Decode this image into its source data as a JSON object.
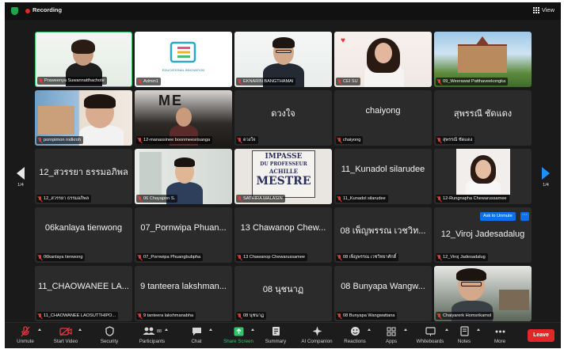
{
  "topbar": {
    "recording_label": "Recording",
    "view_label": "View"
  },
  "pager": {
    "left_page": "1/4",
    "right_page": "1/4"
  },
  "tiles": [
    {
      "name": "Praweenya Suwannatthachote",
      "type": "video"
    },
    {
      "name": "Admin1",
      "type": "video"
    },
    {
      "name": "EKNARIN BANGTHAMAI",
      "type": "video"
    },
    {
      "name": "CEI SU",
      "type": "video"
    },
    {
      "name": "09_Weerawat Patthaveekongka",
      "type": "video"
    },
    {
      "name": "pornpimon rodkroh",
      "type": "video"
    },
    {
      "name": "12-manassinee boonmeesrisanga",
      "type": "video"
    },
    {
      "name": "ดวงใจ",
      "display": "ดวงใจ",
      "type": "text"
    },
    {
      "name": "chaiyong",
      "display": "chaiyong",
      "type": "text"
    },
    {
      "name": "สุพรรณี ชัดแดง",
      "display": "สุพรรณี ชัดแดง",
      "type": "text"
    },
    {
      "name": "12_สวรรยา ธรรมอภิพล",
      "display": "12_สวรรยา ธรรมอภิพล",
      "type": "text"
    },
    {
      "name": "06 Chayapon S.",
      "type": "video"
    },
    {
      "name": "SATHIRA MALASIN",
      "type": "video",
      "sign_lines": [
        "IMPASSE",
        "DU PROFESSEUR",
        "ACHILLE",
        "MESTRE"
      ]
    },
    {
      "name": "11_Kunadol silarudee",
      "display": "11_Kunadol silarudee",
      "type": "text"
    },
    {
      "name": "12-Rungnapha Chewarussamee",
      "type": "video"
    },
    {
      "name": "06kanlaya tienwong",
      "display": "06kanlaya tienwong",
      "type": "text"
    },
    {
      "name": "07_Pornwipa Phuangbubpha",
      "display": "07_Pornwipa Phuan...",
      "type": "text"
    },
    {
      "name": "13 Chawanop Chewarussamee",
      "display": "13 Chawanop Chew...",
      "type": "text"
    },
    {
      "name": "08 เพ็ญพรรณ เวชวิทยาศักดิ์",
      "display": "08 เพ็ญพรรณ เวชวิท...",
      "type": "text"
    },
    {
      "name": "12_Viroj Jadesadalug",
      "display": "12_Viroj Jadesadalug",
      "type": "text",
      "ask_to_unmute": "Ask to Unmute",
      "more": "···"
    },
    {
      "name": "11_CHAOWANEE LAOSUTTHIPO...",
      "display": "11_CHAOWANEE LA...",
      "type": "text"
    },
    {
      "name": "9 tanteera lakshmanabha",
      "display": "9 tanteera lakshman...",
      "type": "text"
    },
    {
      "name": "08 นุชนาฏ",
      "display": "08 นุชนาฏ",
      "type": "text"
    },
    {
      "name": "08 Bunyapa Wangwattana",
      "display": "08 Bunyapa Wangw...",
      "type": "text"
    },
    {
      "name": "Chaiyarerk Homsrikamol",
      "type": "video"
    }
  ],
  "admin_logo_text": "EDUCATIONAL INNOVATION",
  "participants_count": "88",
  "toolbar": {
    "unmute": "Unmute",
    "start_video": "Start Video",
    "security": "Security",
    "participants": "Participants",
    "chat": "Chat",
    "share_screen": "Share Screen",
    "summary": "Summary",
    "ai_companion": "AI Companion",
    "reactions": "Reactions",
    "apps": "Apps",
    "whiteboards": "Whiteboards",
    "notes": "Notes",
    "more": "More",
    "leave": "Leave"
  },
  "colors": {
    "accent_green": "#34c46a",
    "leave_red": "#e02828",
    "unmute_blue": "#0e71eb"
  }
}
